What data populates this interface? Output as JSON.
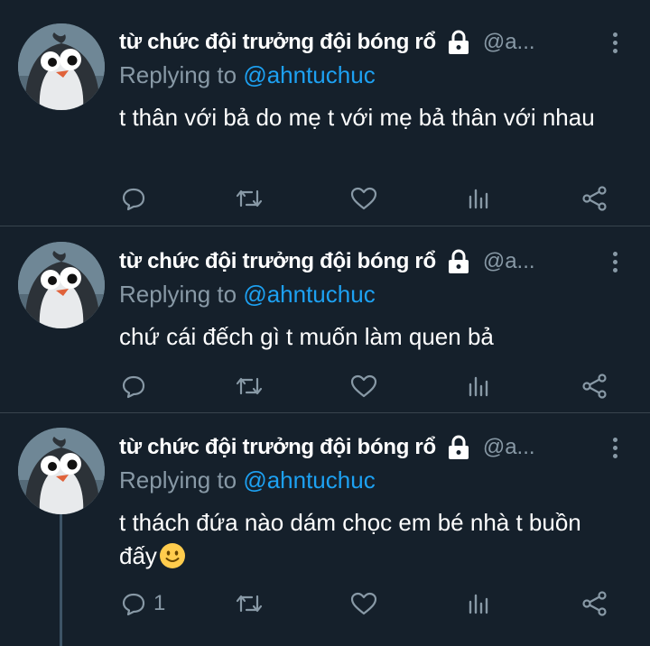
{
  "tweets": [
    {
      "name": "từ chức đội trưởng đội bóng rổ",
      "handle": "@a...",
      "replying_prefix": "Replying to ",
      "replying_to": "@ahntuchuc",
      "text": "t thân với bả do mẹ t với mẹ bả thân với nhau",
      "reply_count": ""
    },
    {
      "name": "từ chức đội trưởng đội bóng rổ",
      "handle": "@a...",
      "replying_prefix": "Replying to ",
      "replying_to": "@ahntuchuc",
      "text": "chứ cái đếch gì t muốn làm quen bả",
      "reply_count": ""
    },
    {
      "name": "từ chức đội trưởng đội bóng rổ",
      "handle": "@a...",
      "replying_prefix": "Replying to ",
      "replying_to": "@ahntuchuc",
      "text": "t thách đứa nào dám chọc em bé nhà t buồn đấy",
      "reply_count": "1"
    }
  ],
  "icons": {
    "reply": "comment-icon",
    "retweet": "retweet-icon",
    "like": "heart-icon",
    "analytics": "analytics-icon",
    "share": "share-icon",
    "lock": "lock-icon",
    "more": "more-vertical-icon",
    "emoji": "slightly-smiling-face-emoji"
  },
  "colors": {
    "background": "#15202b",
    "secondary_text": "#8899a6",
    "link": "#1da1f2",
    "divider": "#38444d"
  }
}
